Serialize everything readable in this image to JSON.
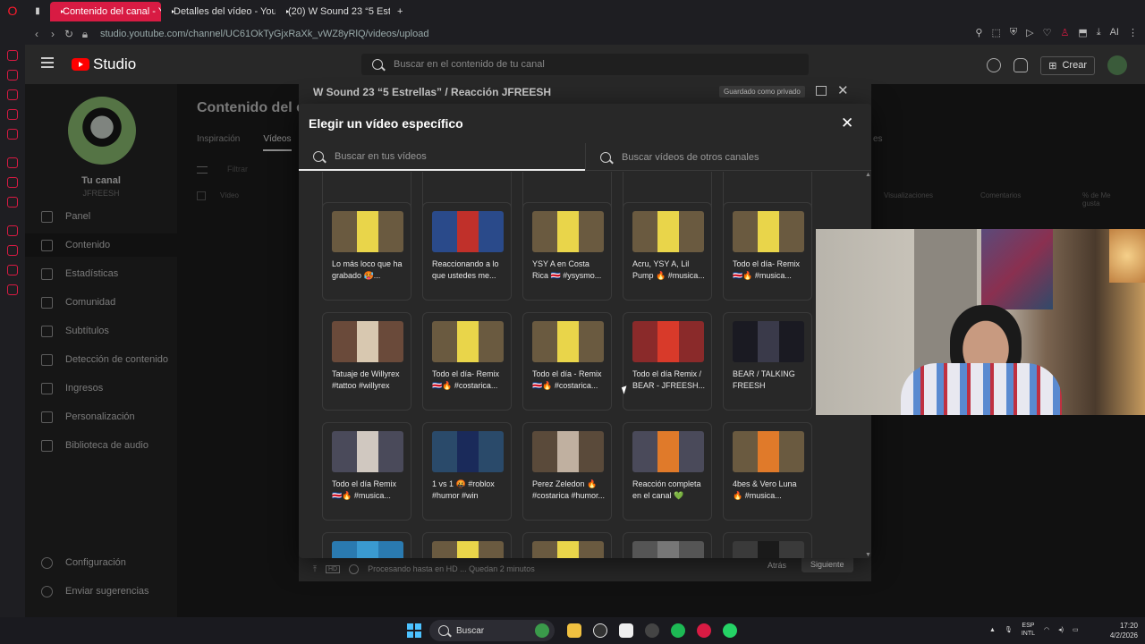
{
  "browser": {
    "tabs": [
      {
        "label": "Contenido del canal - YouT",
        "active": true
      },
      {
        "label": "Detalles del vídeo - YouTu",
        "active": false
      },
      {
        "label": "(20) W Sound 23 “5 Estrellas",
        "active": false
      }
    ],
    "new_tab": "+",
    "url": "studio.youtube.com/channel/UC61OkTyGjxRaXk_vWZ8yRlQ/videos/upload"
  },
  "studio": {
    "logo": "Studio",
    "search_placeholder": "Buscar en el contenido de tu canal",
    "create_label": "Crear",
    "channel_label": "Tu canal",
    "channel_name": "JFREESH",
    "nav": [
      {
        "label": "Panel",
        "icon": "dashboard-icon"
      },
      {
        "label": "Contenido",
        "icon": "content-icon",
        "active": true
      },
      {
        "label": "Estadísticas",
        "icon": "analytics-icon"
      },
      {
        "label": "Comunidad",
        "icon": "community-icon"
      },
      {
        "label": "Subtítulos",
        "icon": "subtitles-icon"
      },
      {
        "label": "Detección de contenido",
        "icon": "copyright-icon"
      },
      {
        "label": "Ingresos",
        "icon": "earn-icon"
      },
      {
        "label": "Personalización",
        "icon": "customization-icon"
      },
      {
        "label": "Biblioteca de audio",
        "icon": "audio-library-icon"
      }
    ],
    "nav_bottom": [
      {
        "label": "Configuración",
        "icon": "settings-icon"
      },
      {
        "label": "Enviar sugerencias",
        "icon": "feedback-icon"
      }
    ],
    "bg_title": "Contenido del ca",
    "bg_tabs": [
      "Inspiración",
      "Vídeos"
    ],
    "bg_tab_extra": "es",
    "bg_filter": "Filtrar",
    "bg_columns": [
      "Vídeo",
      "Visualizaciones",
      "Comentarios",
      "% de Me gusta"
    ]
  },
  "upload_dialog": {
    "title": "W Sound 23 “5 Estrellas” / Reacción JFREESH",
    "saved_badge": "Guardado como privado",
    "status": "Procesando hasta en HD ... Quedan 2 minutos",
    "back_label": "Atrás",
    "next_label": "Siguiente"
  },
  "modal": {
    "title": "Elegir un vídeo específico",
    "search_own_placeholder": "Buscar en tus vídeos",
    "search_other_placeholder": "Buscar vídeos de otros canales",
    "videos": [
      {
        "title": "Lo más loco que ha grabado 🥵...",
        "thumb": "#6a5a40",
        "accent": "#e9d54a"
      },
      {
        "title": "Reaccionando a lo que ustedes me...",
        "thumb": "#2a4a8a",
        "accent": "#c0302a"
      },
      {
        "title": "YSY A en Costa Rica 🇨🇷 #ysysmo...",
        "thumb": "#6a5a40",
        "accent": "#e9d54a"
      },
      {
        "title": "Acru, YSY A, Lil Pump 🔥 #musica...",
        "thumb": "#6a5a40",
        "accent": "#e9d54a"
      },
      {
        "title": "Todo el día- Remix 🇨🇷🔥 #musica...",
        "thumb": "#6a5a40",
        "accent": "#e9d54a"
      },
      {
        "title": "Tatuaje de Willyrex #tattoo #willyrex",
        "thumb": "#6a4a3a",
        "accent": "#d8c8b0"
      },
      {
        "title": "Todo el día- Remix 🇨🇷🔥 #costarica...",
        "thumb": "#6a5a40",
        "accent": "#e9d54a"
      },
      {
        "title": "Todo el día - Remix 🇨🇷🔥 #costarica...",
        "thumb": "#6a5a40",
        "accent": "#e9d54a"
      },
      {
        "title": "Todo el día Remix / BEAR - JFREESH...",
        "thumb": "#8a2a2a",
        "accent": "#d83a2a"
      },
      {
        "title": "BEAR / TALKING FREESH",
        "thumb": "#1a1a22",
        "accent": "#3a3a4a"
      },
      {
        "title": "Todo el día Remix 🇨🇷🔥 #musica...",
        "thumb": "#4a4a5a",
        "accent": "#d0c8c0"
      },
      {
        "title": "1 vs 1 🤬 #roblox #humor #win",
        "thumb": "#2a4a6a",
        "accent": "#1a2a5a"
      },
      {
        "title": "Perez Zeledon 🔥 #costarica #humor...",
        "thumb": "#5a4a3a",
        "accent": "#c0b0a0"
      },
      {
        "title": "Reacción completa en el canal 💚",
        "thumb": "#4a4a5a",
        "accent": "#e07a2a"
      },
      {
        "title": "4bes & Vero Luna 🔥 #musica...",
        "thumb": "#6a5a40",
        "accent": "#e07a2a"
      },
      {
        "title": "",
        "thumb": "#2a7ab0",
        "accent": "#3a9ad0"
      },
      {
        "title": "",
        "thumb": "#6a5a40",
        "accent": "#e9d54a"
      },
      {
        "title": "",
        "thumb": "#6a5a40",
        "accent": "#e9d54a"
      },
      {
        "title": "",
        "thumb": "#555555",
        "accent": "#777777"
      },
      {
        "title": "",
        "thumb": "#3a3a3a",
        "accent": "#1a1a1a"
      }
    ]
  },
  "taskbar": {
    "search_label": "Buscar",
    "lang_top": "ESP",
    "lang_bottom": "INTL",
    "time": "17:20",
    "date": "4/2/2026"
  }
}
